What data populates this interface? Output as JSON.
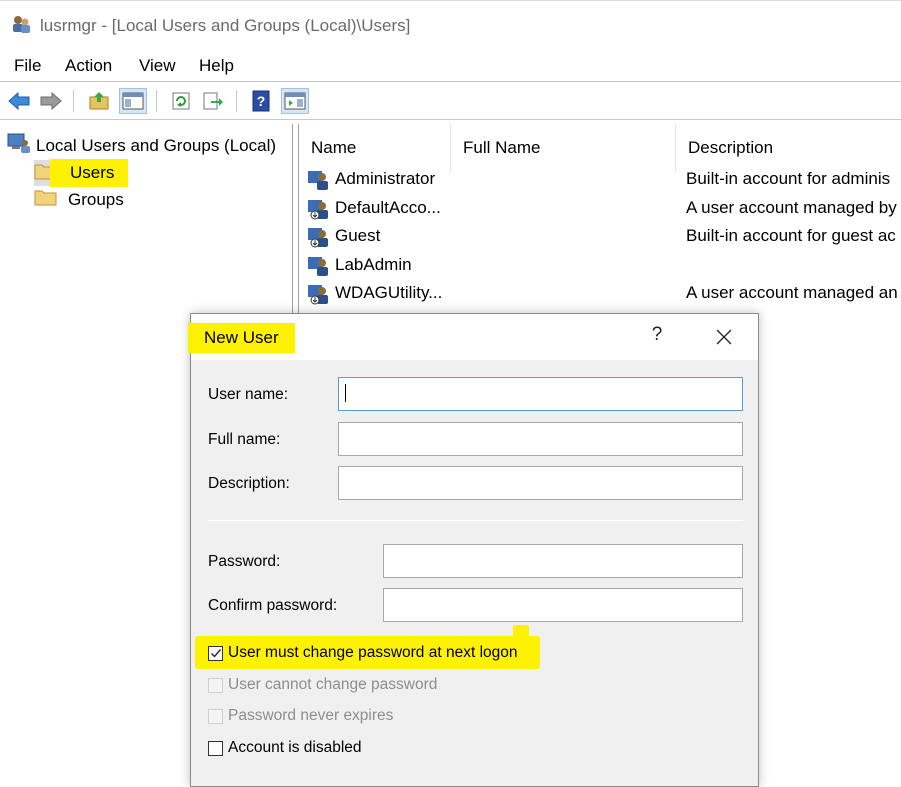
{
  "window": {
    "title": "lusrmgr - [Local Users and Groups (Local)\\Users]",
    "icon": "users-mmc-icon"
  },
  "menu": [
    "File",
    "Action",
    "View",
    "Help"
  ],
  "toolbar": {
    "buttons": [
      "back-arrow-icon",
      "forward-arrow-icon",
      "up-folder-icon",
      "show-hide-tree-icon",
      "refresh-icon",
      "export-list-icon",
      "help-icon",
      "show-action-pane-icon"
    ]
  },
  "tree": {
    "root": "Local Users and Groups (Local)",
    "children": [
      "Users",
      "Groups"
    ],
    "selected": "Users"
  },
  "list": {
    "columns": [
      "Name",
      "Full Name",
      "Description"
    ],
    "rows": [
      {
        "name": "Administrator",
        "full_name": "",
        "description": "Built-in account for adminis"
      },
      {
        "name": "DefaultAcco...",
        "full_name": "",
        "description": "A user account managed by"
      },
      {
        "name": "Guest",
        "full_name": "",
        "description": "Built-in account for guest ac"
      },
      {
        "name": "LabAdmin",
        "full_name": "",
        "description": ""
      },
      {
        "name": "WDAGUtility...",
        "full_name": "",
        "description": "A user account managed an"
      }
    ]
  },
  "dialog": {
    "title": "New User",
    "help": "?",
    "fields": {
      "user_name_label": "User name:",
      "user_name_value": "",
      "full_name_label": "Full name:",
      "full_name_value": "",
      "description_label": "Description:",
      "description_value": "",
      "password_label": "Password:",
      "confirm_password_label": "Confirm password:"
    },
    "checkboxes": [
      {
        "label": "User must change password at next logon",
        "checked": true,
        "enabled": true
      },
      {
        "label": "User cannot change password",
        "checked": false,
        "enabled": false
      },
      {
        "label": "Password never expires",
        "checked": false,
        "enabled": false
      },
      {
        "label": "Account is disabled",
        "checked": false,
        "enabled": true
      }
    ]
  },
  "colors": {
    "highlight": "#fff200",
    "focus_border": "#5b9bd5",
    "dialog_bg": "#f0f0f0"
  }
}
